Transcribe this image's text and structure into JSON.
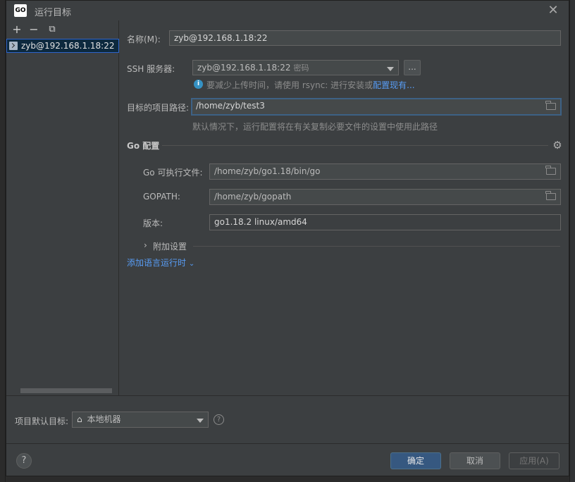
{
  "window": {
    "app_icon": "GO",
    "title": "运行目标"
  },
  "left_panel": {
    "toolbar": {
      "add": "+",
      "remove": "−",
      "copy": "⧉"
    },
    "targets": [
      {
        "name": "zyb@192.168.1.18:22",
        "suffix": "G"
      }
    ]
  },
  "form": {
    "name_label": "名称(M):",
    "name_value": "zyb@192.168.1.18:22",
    "ssh_label": "SSH 服务器:",
    "ssh_value": "zyb@192.168.1.18:22",
    "ssh_value_sub": "密码",
    "ssh_more": "...",
    "ssh_hint": "要减少上传时间，请使用 rsync: 进行安装或",
    "ssh_hint_link": "配置现有...",
    "path_label": "目标的项目路径:",
    "path_value": "/home/zyb/test3",
    "path_hint": "默认情况下，运行配置将在有关复制必要文件的设置中使用此路径"
  },
  "go_config": {
    "title": "Go 配置",
    "exec_label": "Go 可执行文件:",
    "exec_value": "/home/zyb/go1.18/bin/go",
    "gopath_label": "GOPATH:",
    "gopath_value": "/home/zyb/gopath",
    "version_label": "版本:",
    "version_value": "go1.18.2 linux/amd64",
    "extra_settings": "附加设置",
    "add_runtime": "添加语言运行时"
  },
  "footer": {
    "default_target_label": "项目默认目标:",
    "default_target_value": "本地机器",
    "ok": "确定",
    "cancel": "取消",
    "apply": "应用(A)",
    "help": "?"
  },
  "colors": {
    "accent": "#365880",
    "link": "#589df6",
    "selection": "#0d293e",
    "focus": "#3d6185"
  }
}
